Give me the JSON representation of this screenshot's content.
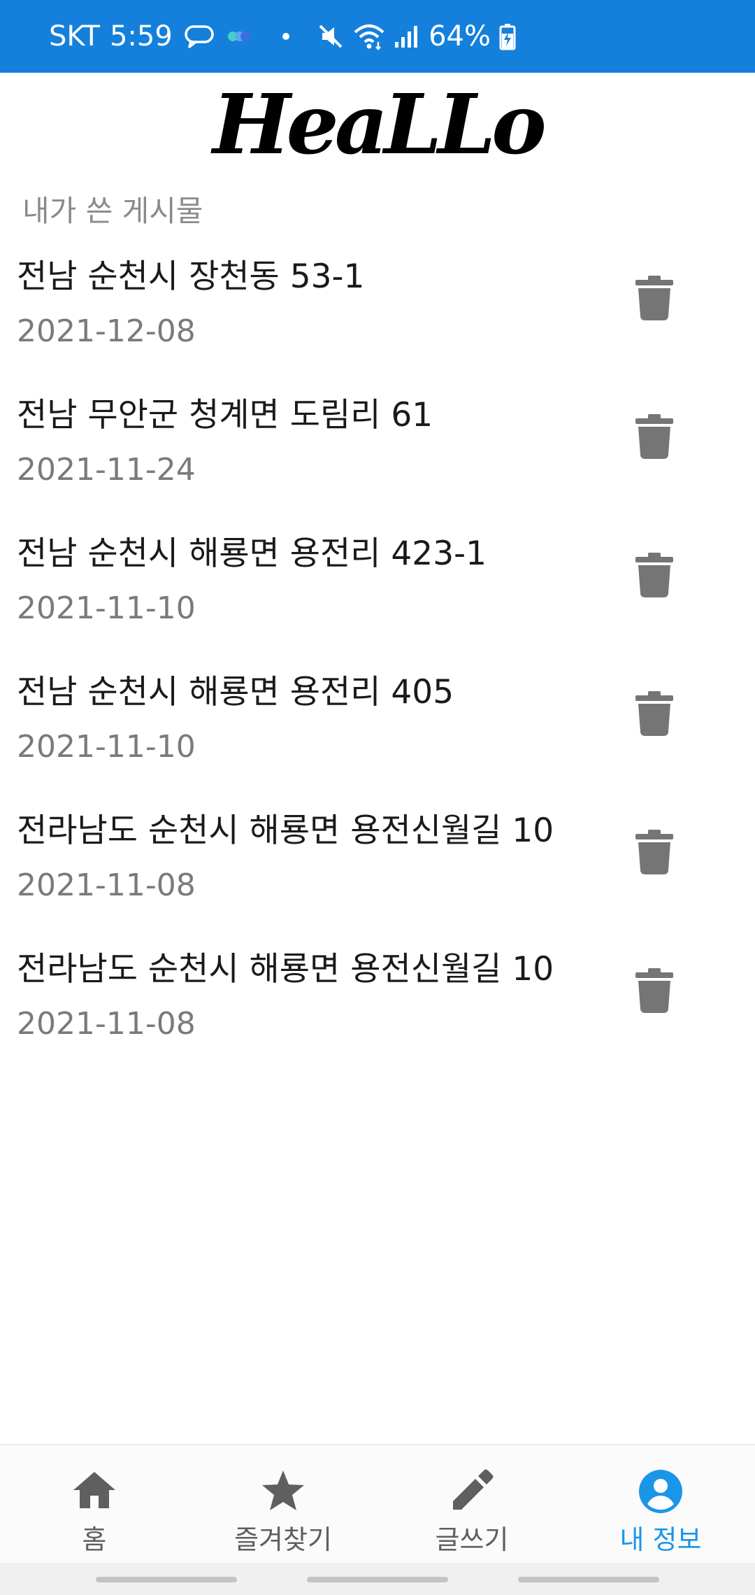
{
  "status_bar": {
    "carrier": "SKT",
    "time": "5:59",
    "battery": "64%",
    "icons": [
      "chat-bubble-icon",
      "app-dots-icon",
      "dot-icon",
      "mute-icon",
      "wifi-icon",
      "signal-icon",
      "battery-charging-icon"
    ],
    "background_color": "#1480db"
  },
  "app": {
    "logo_text": "HeaLLo"
  },
  "section": {
    "title": "내가 쓴 게시물"
  },
  "posts": [
    {
      "title": "전남 순천시 장천동 53-1",
      "date": "2021-12-08"
    },
    {
      "title": "전남 무안군 청계면 도림리 61",
      "date": "2021-11-24"
    },
    {
      "title": "전남 순천시 해룡면 용전리 423-1",
      "date": "2021-11-10"
    },
    {
      "title": "전남 순천시 해룡면 용전리 405",
      "date": "2021-11-10"
    },
    {
      "title": "전라남도 순천시 해룡면 용전신월길 10",
      "date": "2021-11-08"
    },
    {
      "title": "전라남도 순천시 해룡면 용전신월길 10",
      "date": "2021-11-08"
    }
  ],
  "bottom_nav": {
    "items": [
      {
        "label": "홈",
        "icon": "home-icon"
      },
      {
        "label": "즐겨찾기",
        "icon": "star-icon"
      },
      {
        "label": "글쓰기",
        "icon": "pencil-icon"
      },
      {
        "label": "내 정보",
        "icon": "account-circle-icon"
      }
    ],
    "active_index": 3,
    "active_color": "#1a96e8",
    "inactive_color": "#5f5f5f"
  }
}
